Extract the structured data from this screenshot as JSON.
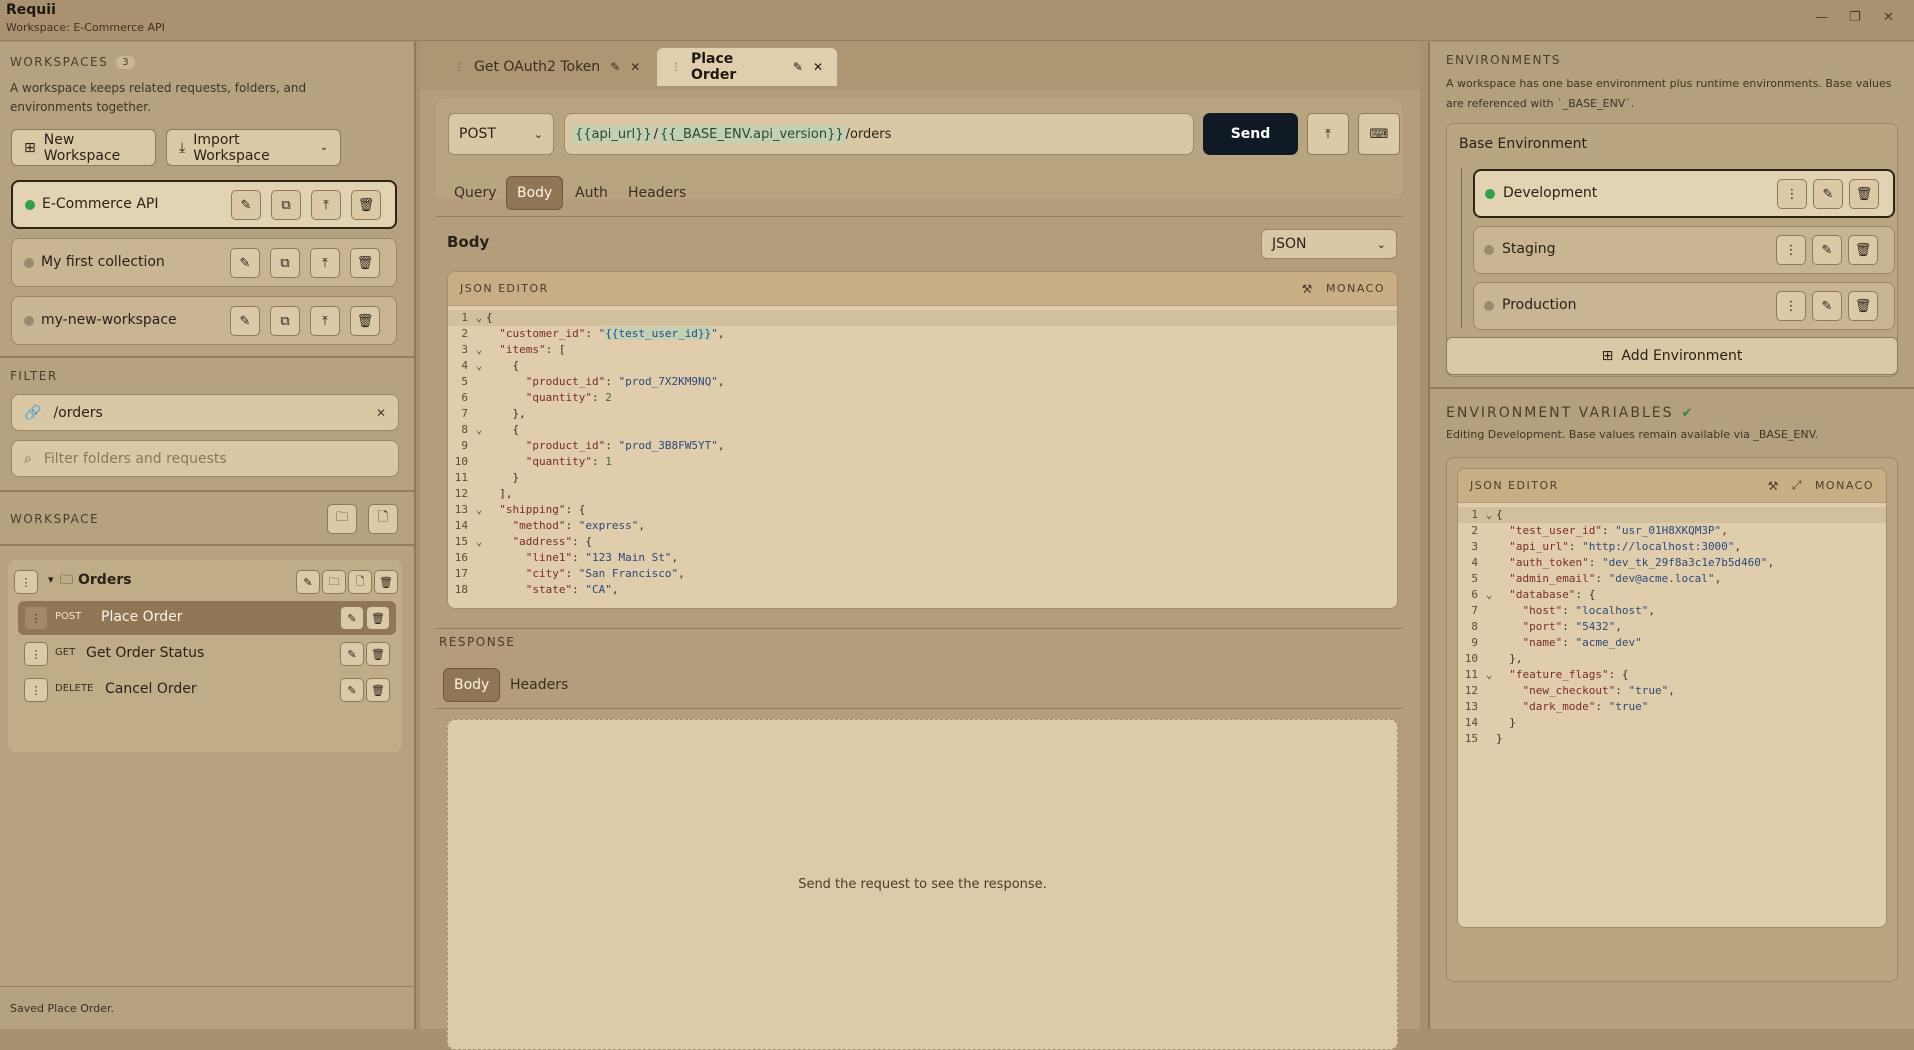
{
  "app": {
    "name": "Requii",
    "workspace_subtitle": "Workspace: E-Commerce API"
  },
  "window_controls": {
    "minimize": "—",
    "restore": "❐",
    "close": "✕"
  },
  "left": {
    "workspaces_heading": "WORKSPACES",
    "workspaces_count": "3",
    "workspaces_desc": "A workspace keeps related requests, folders, and environments together.",
    "new_workspace_label": "New Workspace",
    "import_workspace_label": "Import Workspace",
    "workspaces": [
      {
        "name": "E-Commerce API",
        "active": true
      },
      {
        "name": "My first collection",
        "active": false
      },
      {
        "name": "my-new-workspace",
        "active": false
      }
    ],
    "filter_heading": "FILTER",
    "filter_value": "/orders",
    "filter_placeholder": "Filter folders and requests",
    "workspace_heading": "WORKSPACE",
    "folder_name": "Orders",
    "requests": [
      {
        "method": "POST",
        "name": "Place Order"
      },
      {
        "method": "GET",
        "name": "Get Order Status"
      },
      {
        "method": "DELETE",
        "name": "Cancel Order"
      }
    ],
    "status": "Saved Place Order."
  },
  "mid": {
    "tabs": [
      {
        "label": "Get OAuth2 Token"
      },
      {
        "label": "Place Order"
      }
    ],
    "method": "POST",
    "url_var1": "{{api_url}}",
    "url_sep": "/",
    "url_var2": "{{_BASE_ENV.api_version}}",
    "url_tail": "/orders",
    "send_label": "Send",
    "request_tabs": [
      "Query",
      "Body",
      "Auth",
      "Headers"
    ],
    "body_title": "Body",
    "body_format": "JSON",
    "editor_label": "JSON EDITOR",
    "editor_engine": "MONACO",
    "response_heading": "RESPONSE",
    "response_tabs": [
      "Body",
      "Headers"
    ],
    "response_empty": "Send the request to see the response."
  },
  "right": {
    "env_heading": "ENVIRONMENTS",
    "env_desc": "A workspace has one base environment plus runtime environments. Base values are referenced with `_BASE_ENV`.",
    "base_env": "Base Environment",
    "envs": [
      {
        "name": "Development",
        "active": true
      },
      {
        "name": "Staging",
        "active": false
      },
      {
        "name": "Production",
        "active": false
      }
    ],
    "add_env_label": "Add Environment",
    "vars_heading": "ENVIRONMENT VARIABLES",
    "vars_desc": "Editing Development. Base values remain available via _BASE_ENV.",
    "editor_label": "JSON EDITOR",
    "editor_engine": "MONACO"
  }
}
